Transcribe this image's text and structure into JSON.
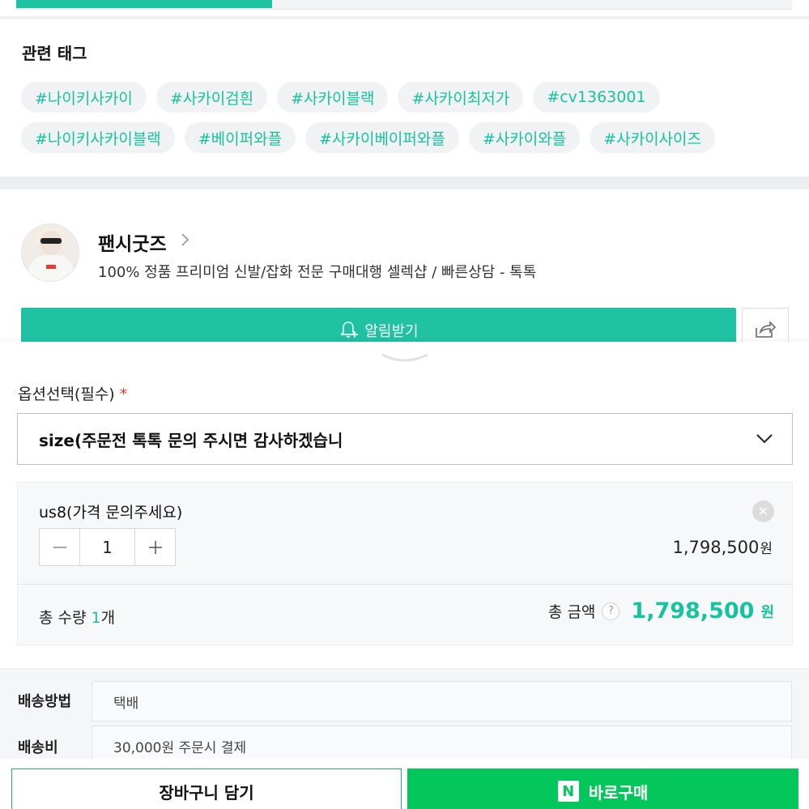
{
  "tags": {
    "title": "관련 태그",
    "row1": [
      "#나이키사카이",
      "#사카이검흰",
      "#사카이블랙",
      "#사카이최저가",
      "#cv1363001"
    ],
    "row2": [
      "#나이키사카이블랙",
      "#베이퍼와플",
      "#사카이베이퍼와플",
      "#사카이와플",
      "#사카이사이즈"
    ]
  },
  "seller": {
    "name": "팬시굿즈",
    "description": "100% 정품 프리미엄 신발/잡화 전문 구매대행 셀렉샵 / 빠른상담 - 톡톡",
    "notify_label": "알림받기"
  },
  "option": {
    "label": "옵션선택(필수)",
    "required_mark": "*",
    "selected": "size(주문전 톡톡 문의 주시면 감사하겠습니"
  },
  "item": {
    "name": "us8(가격 문의주세요)",
    "quantity": "1",
    "price": "1,798,500",
    "currency": "원"
  },
  "total": {
    "qty_label": "총 수량",
    "qty_value": "1",
    "qty_unit": "개",
    "amount_label": "총 금액",
    "help": "?",
    "amount": "1,798,500",
    "currency": "원"
  },
  "shipping": {
    "method_label": "배송방법",
    "method_value": "택배",
    "fee_label": "배송비",
    "fee_value": "30,000원 주문시 결제"
  },
  "actions": {
    "cart_label": "장바구니 담기",
    "buy_label": "바로구매",
    "npay_glyph": "N"
  },
  "colors": {
    "accent": "#1fc3a3",
    "buy_green": "#03c75a",
    "required": "#e53935"
  },
  "progress": {
    "fill_fraction": 0.33
  }
}
